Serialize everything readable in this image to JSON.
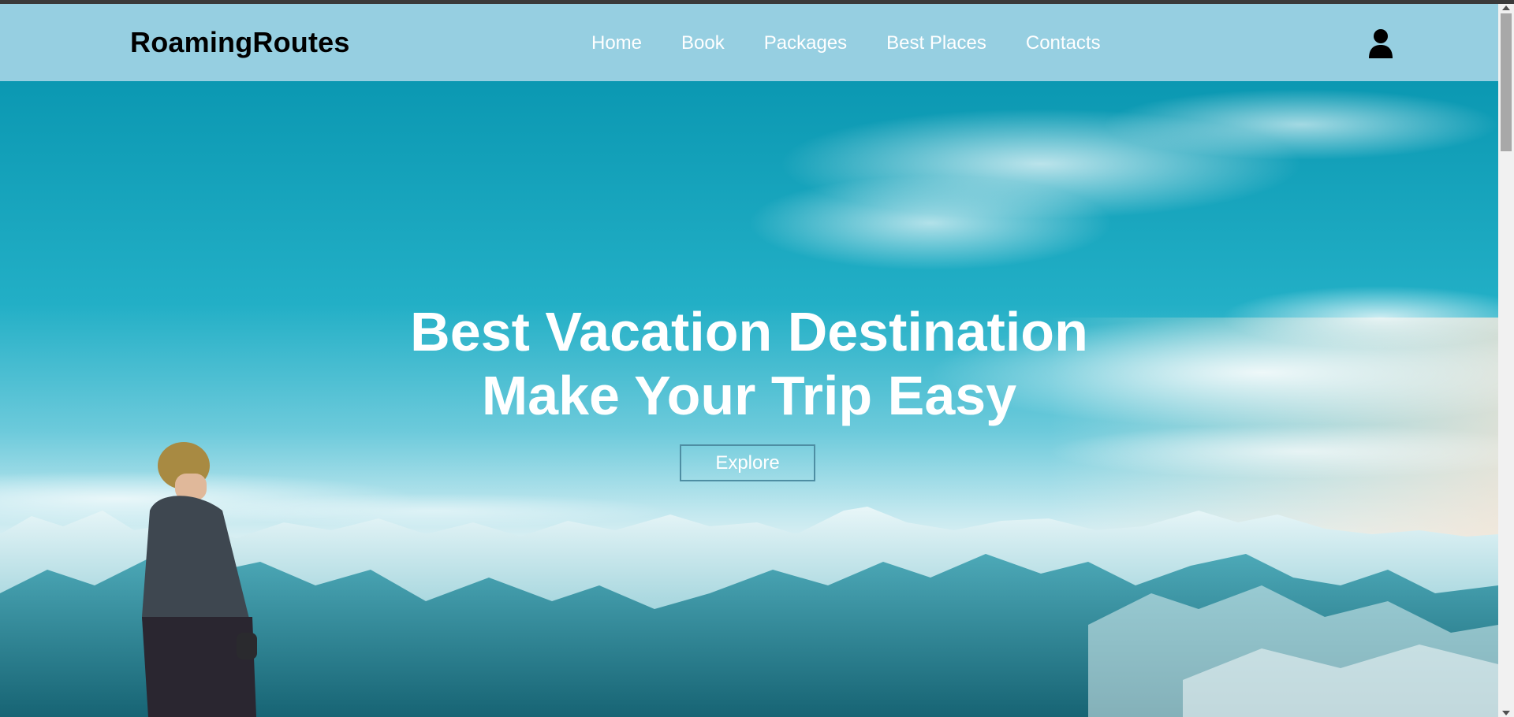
{
  "brand": {
    "logo_text": "RoamingRoutes"
  },
  "nav": {
    "items": [
      {
        "label": "Home"
      },
      {
        "label": "Book"
      },
      {
        "label": "Packages"
      },
      {
        "label": "Best Places"
      },
      {
        "label": "Contacts"
      }
    ],
    "user_icon": "user-icon"
  },
  "hero": {
    "title_line1": "Best Vacation Destination",
    "title_line2": "Make Your Trip Easy",
    "button_label": "Explore"
  },
  "colors": {
    "navbar_bg": "#96cfe1",
    "sky_top": "#0e9ab3",
    "sky_bottom": "#bfe6ef",
    "text": "#ffffff",
    "button_border": "#4e8ea3"
  }
}
